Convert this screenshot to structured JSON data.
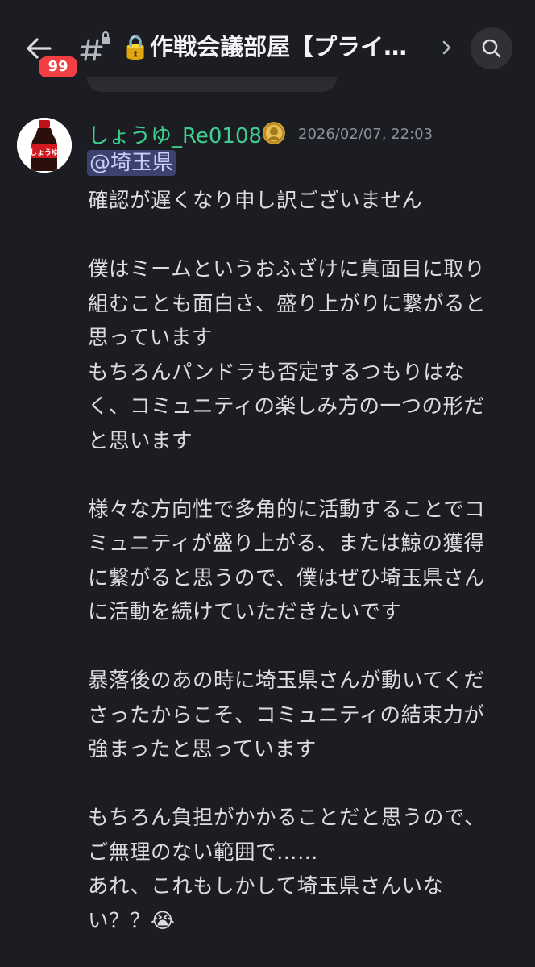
{
  "header": {
    "back_label": "←",
    "unread_badge": "99",
    "channel_title": "🔒作戦会議部屋【プライ…",
    "icons": [
      "back-arrow-icon",
      "locked-channel-hash-icon",
      "chevron-right-icon",
      "search-icon"
    ]
  },
  "message": {
    "author": "しょうゆ_Re0108",
    "author_color": "#3ecf8e",
    "timestamp": "2026/02/07, 22:03",
    "mention": "@埼玉県",
    "avatar_label": "しょうゆ",
    "lines": [
      "確認が遅くなり申し訳ございません",
      "",
      "僕はミームというおふざけに真面目に取り",
      "組むことも面白さ、盛り上がりに繋がると",
      "思っています",
      "もちろんパンドラも否定するつもりはな",
      "く、コミュニティの楽しみ方の一つの形だ",
      "と思います",
      "",
      "様々な方向性で多角的に活動することでコ",
      "ミュニティが盛り上がる、または鯨の獲得",
      "に繋がると思うので、僕はぜひ埼玉県さん",
      "に活動を続けていただきたいです",
      "",
      "暴落後のあの時に埼玉県さんが動いてくだ",
      "さったからこそ、コミュニティの結束力が",
      "強まったと思っています",
      "",
      "もちろん負担がかかることだと思うので、",
      "ご無理のない範囲で……",
      "あれ、これもしかして埼玉県さんいな",
      "い？？😭"
    ]
  }
}
